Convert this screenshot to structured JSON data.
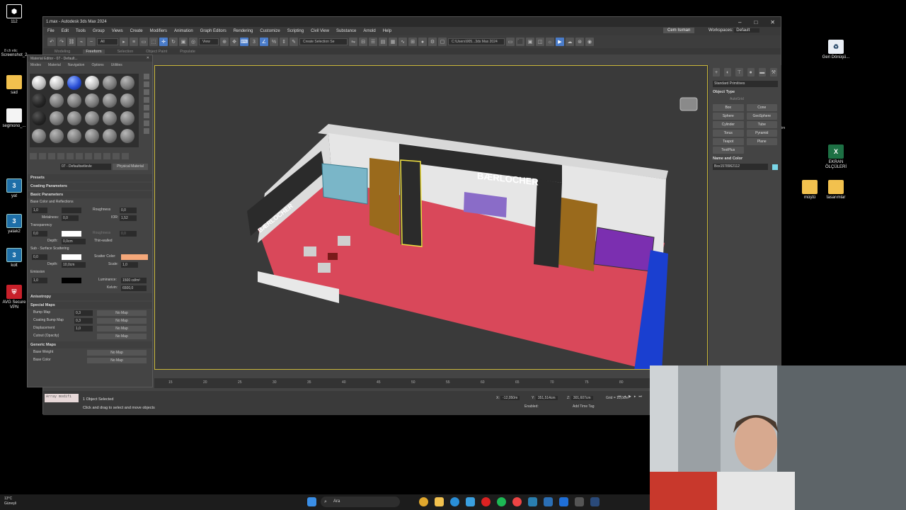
{
  "desktop": {
    "icons": [
      {
        "label": "112",
        "glyph": "⬢",
        "kind": "cube"
      },
      {
        "label": "Screenshot_2",
        "glyph": "",
        "kind": "file"
      },
      {
        "label": "sad",
        "glyph": "",
        "kind": "folder"
      },
      {
        "label": "segmono_...",
        "glyph": "",
        "kind": "file"
      },
      {
        "label": "yat",
        "glyph": "3",
        "kind": "max3"
      },
      {
        "label": "yatak2",
        "glyph": "3",
        "kind": "max3"
      },
      {
        "label": "kolt",
        "glyph": "3",
        "kind": "max3"
      },
      {
        "label": "AVG Secure VPN",
        "glyph": "⛨",
        "kind": "avg"
      },
      {
        "label": "Geri Dönüşü...",
        "glyph": "♻",
        "kind": "recycle"
      },
      {
        "label": "EKRAN ÖLÇÜLERİ",
        "glyph": "X",
        "kind": "excel"
      },
      {
        "label": "müştü",
        "glyph": "",
        "kind": "folder"
      },
      {
        "label": "tasarımlar",
        "glyph": "",
        "kind": "folder"
      }
    ],
    "small_label": "8 ch etic",
    "side_label": "im"
  },
  "window": {
    "title": "1.max - Autodesk 3ds Max 2024",
    "controls": [
      "–",
      "□",
      "✕"
    ],
    "menu": [
      "File",
      "Edit",
      "Tools",
      "Group",
      "Views",
      "Create",
      "Modifiers",
      "Animation",
      "Graph Editors",
      "Rendering",
      "Customize",
      "Scripting",
      "Civil View",
      "Substance",
      "Arnold",
      "Help"
    ],
    "user": "Cem Isıman",
    "workspace_label": "Workspaces:",
    "workspace_value": "Default",
    "toolbar": {
      "filter": "All",
      "view": "View",
      "selection_set": "Create Selection Se",
      "path": "C:\\Users\\905...3ds Max 2024"
    },
    "ribbon": [
      "Modeling",
      "Freeform",
      "Selection",
      "Object Paint",
      "Populate"
    ]
  },
  "material_editor": {
    "title": "Material Editor - 07 - Default...",
    "menu": [
      "Modes",
      "Material",
      "Navigation",
      "Options",
      "Utilities"
    ],
    "material_name": "07 - Defaultsetlevle",
    "material_type": "Physical Material",
    "sections": {
      "presets": "Presets",
      "coating": "Coating Parameters",
      "basic": "Basic Parameters",
      "base_color_reflections": "Base Color and Reflections",
      "transparency": "Transparency",
      "sss": "Sub - Surface Scattering",
      "emission": "Emission",
      "anisotropy": "Anisotropy",
      "special_maps": "Special Maps",
      "generic_maps": "Generic Maps"
    },
    "params": {
      "base_weight": "1,0",
      "roughness_label": "Roughness",
      "roughness": "0,0",
      "metalness_label": "Metalness:",
      "metalness": "0,0",
      "ior_label": "IOR:",
      "ior": "1,52",
      "transparency_weight": "0,0",
      "roughness2_label": "Roughness",
      "roughness2": "0,0",
      "depth_label": "Depth:",
      "depth": "0,0cm",
      "thin_walled": "Thin-walled",
      "sss_weight": "0,0",
      "scatter_color_label": "Scatter Color:",
      "sss_depth_label": "Depth:",
      "sss_depth": "10,0cm",
      "scale_label": "Scale:",
      "scale": "1,0",
      "emission_weight": "1,0",
      "luminance_label": "Luminance:",
      "luminance": "1500 cd/m²",
      "kelvin_label": "Kelvin:",
      "kelvin": "6500,0"
    },
    "special_maps": [
      {
        "label": "Bump Map",
        "value": "0,3",
        "map": "No Map"
      },
      {
        "label": "Coating Bump Map",
        "value": "0,3",
        "map": "No Map"
      },
      {
        "label": "Displacement",
        "value": "1,0",
        "map": "No Map"
      },
      {
        "label": "Cutout (Opacity)",
        "value": "",
        "map": "No Map"
      }
    ],
    "generic_maps": [
      {
        "label": "Base Weight",
        "map": "No Map"
      },
      {
        "label": "Base Color",
        "map": "No Map"
      }
    ]
  },
  "viewport": {
    "brand_text": "BÆRLOCHER",
    "colors": {
      "floor": "#d9485a",
      "wall": "#e6e6e6",
      "brown": "#9a6a1c",
      "purple": "#7b2fb0",
      "blue": "#1a3fd0",
      "dark": "#2b2b2b"
    }
  },
  "command_panel": {
    "category": "Standard Primitives",
    "object_type_title": "Object Type",
    "autogrid": "AutoGrid",
    "buttons": [
      "Box",
      "Cone",
      "Sphere",
      "GeoSphere",
      "Cylinder",
      "Tube",
      "Torus",
      "Pyramid",
      "Teapot",
      "Plane",
      "TextPlus"
    ],
    "name_color_title": "Name and Color",
    "object_name": "Box1578962112"
  },
  "timeline": {
    "ticks": [
      "15",
      "20",
      "25",
      "30",
      "35",
      "40",
      "45",
      "50",
      "55",
      "60",
      "65",
      "70",
      "75",
      "80"
    ]
  },
  "status": {
    "script_text": "Array modifi",
    "selected": "1 Object Selected",
    "hint": "Click and drag to select and move objects",
    "x_label": "X:",
    "x": "-12,050m",
    "y_label": "Y:",
    "y": "351,514cm",
    "z_label": "Z:",
    "z": "301,607cm",
    "grid": "Grid = 10,0cm",
    "enabled": "Enabled:",
    "add_time_tag": "Add Time Tag"
  },
  "taskbar": {
    "temp": "13°C",
    "weather": "Güneşli",
    "search_placeholder": "Ara"
  }
}
